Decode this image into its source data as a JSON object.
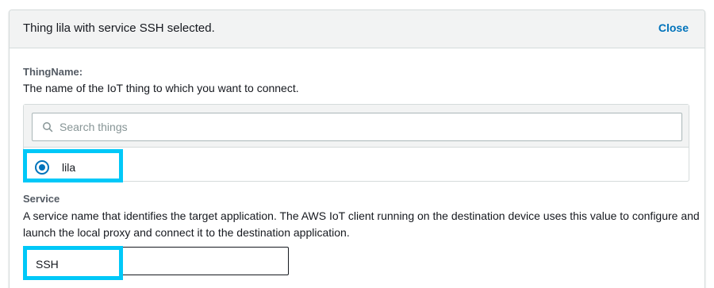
{
  "panel": {
    "title": "Thing lila with service SSH selected.",
    "close_label": "Close"
  },
  "thing_name": {
    "label": "ThingName:",
    "description": "The name of the IoT thing to which you want to connect.",
    "search_placeholder": "Search things",
    "search_icon": "search-icon",
    "selected_thing": "lila"
  },
  "service": {
    "label": "Service",
    "description_line1": "A service name that identifies the target application. The AWS IoT client running on the destination device uses this value to configure and",
    "description_line2": "launch the local proxy and connect it to the destination application.",
    "value": "SSH"
  },
  "colors": {
    "accent": "#0073bb",
    "highlight": "#00c8f8",
    "header_bg": "#f2f3f3"
  }
}
